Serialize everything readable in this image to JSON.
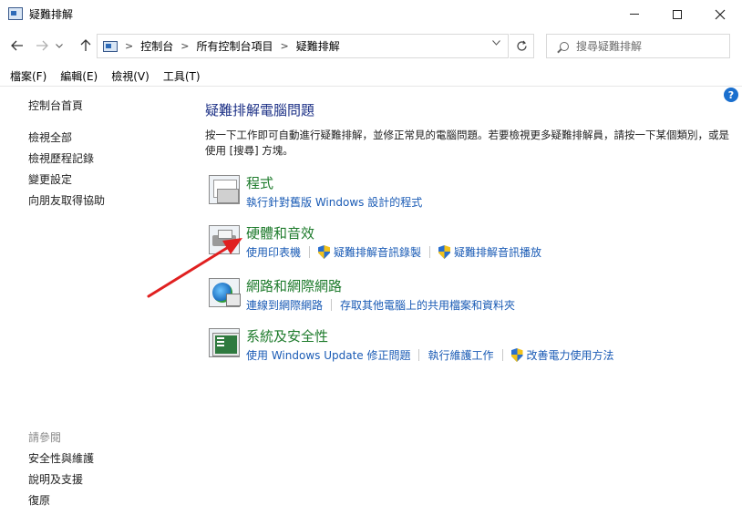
{
  "window": {
    "title": "疑難排解"
  },
  "nav": {
    "breadcrumbs": [
      "控制台",
      "所有控制台項目",
      "疑難排解"
    ],
    "search_placeholder": "搜尋疑難排解"
  },
  "menu": [
    "檔案(F)",
    "編輯(E)",
    "檢視(V)",
    "工具(T)"
  ],
  "sidebar": {
    "home": "控制台首頁",
    "items": [
      "檢視全部",
      "檢視歷程記錄",
      "變更設定",
      "向朋友取得協助"
    ],
    "see_also_heading": "請參閱",
    "see_also": [
      "安全性與維護",
      "說明及支援",
      "復原"
    ]
  },
  "main": {
    "title": "疑難排解電腦問題",
    "description": "按一下工作即可自動進行疑難排解，並修正常見的電腦問題。若要檢視更多疑難排解員，請按一下某個類別，或是使用 [搜尋] 方塊。",
    "categories": [
      {
        "title": "程式",
        "icon": "programs-icon",
        "links": [
          {
            "label": "執行針對舊版 Windows 設計的程式",
            "shield": false
          }
        ]
      },
      {
        "title": "硬體和音效",
        "icon": "hardware-sound-icon",
        "links": [
          {
            "label": "使用印表機",
            "shield": false
          },
          {
            "label": "疑難排解音訊錄製",
            "shield": true
          },
          {
            "label": "疑難排解音訊播放",
            "shield": true
          }
        ]
      },
      {
        "title": "網路和網際網路",
        "icon": "network-icon",
        "links": [
          {
            "label": "連線到網際網路",
            "shield": false
          },
          {
            "label": "存取其他電腦上的共用檔案和資料夾",
            "shield": false
          }
        ]
      },
      {
        "title": "系統及安全性",
        "icon": "system-security-icon",
        "links": [
          {
            "label": "使用 Windows Update 修正問題",
            "shield": false
          },
          {
            "label": "執行維護工作",
            "shield": false
          },
          {
            "label": "改善電力使用方法",
            "shield": true
          }
        ]
      }
    ]
  },
  "colors": {
    "category_title": "#1e7b2c",
    "link": "#1a5bb5",
    "page_title": "#1e3287",
    "annotation_arrow": "#e02020"
  }
}
